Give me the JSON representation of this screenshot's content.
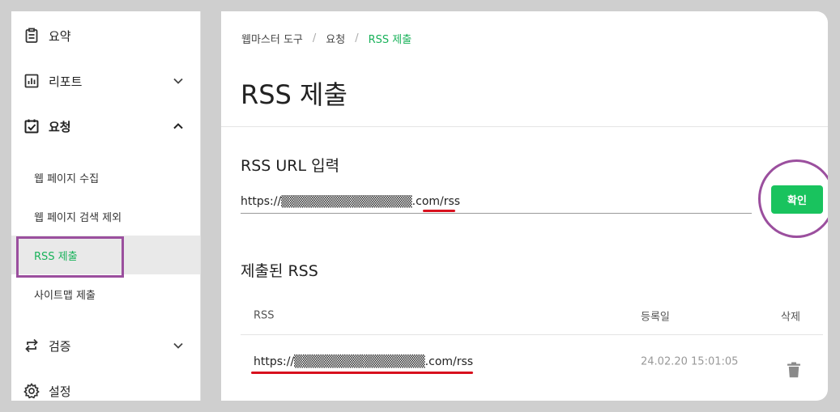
{
  "sidebar": {
    "summary": {
      "label": "요약",
      "icon": "clipboard-icon"
    },
    "report": {
      "label": "리포트",
      "icon": "bar-chart-icon"
    },
    "request": {
      "label": "요청",
      "icon": "calendar-check-icon"
    },
    "sub_items": [
      {
        "label": "웹 페이지 수집"
      },
      {
        "label": "웹 페이지 검색 제외"
      },
      {
        "label": "RSS 제출"
      },
      {
        "label": "사이트맵 제출"
      }
    ],
    "verify": {
      "label": "검증",
      "icon": "swap-icon"
    },
    "settings": {
      "label": "설정",
      "icon": "gear-icon"
    }
  },
  "breadcrumb": [
    "웹마스터 도구",
    "요청",
    "RSS 제출"
  ],
  "page_title": "RSS 제출",
  "rss_input": {
    "label": "RSS URL 입력",
    "value": "https://▒▒▒▒▒▒▒▒▒▒▒▒▒▒▒.com/rss",
    "button_label": "확인"
  },
  "submitted": {
    "title": "제출된 RSS",
    "columns": [
      "RSS",
      "등록일",
      "삭제"
    ],
    "rows": [
      {
        "url": "https://▒▒▒▒▒▒▒▒▒▒▒▒▒▒▒.com/rss",
        "date": "24.02.20 15:01:05"
      }
    ]
  },
  "colors": {
    "accent": "#19c35e",
    "annotation": "#9b4f9e",
    "underline": "#d8111e"
  }
}
